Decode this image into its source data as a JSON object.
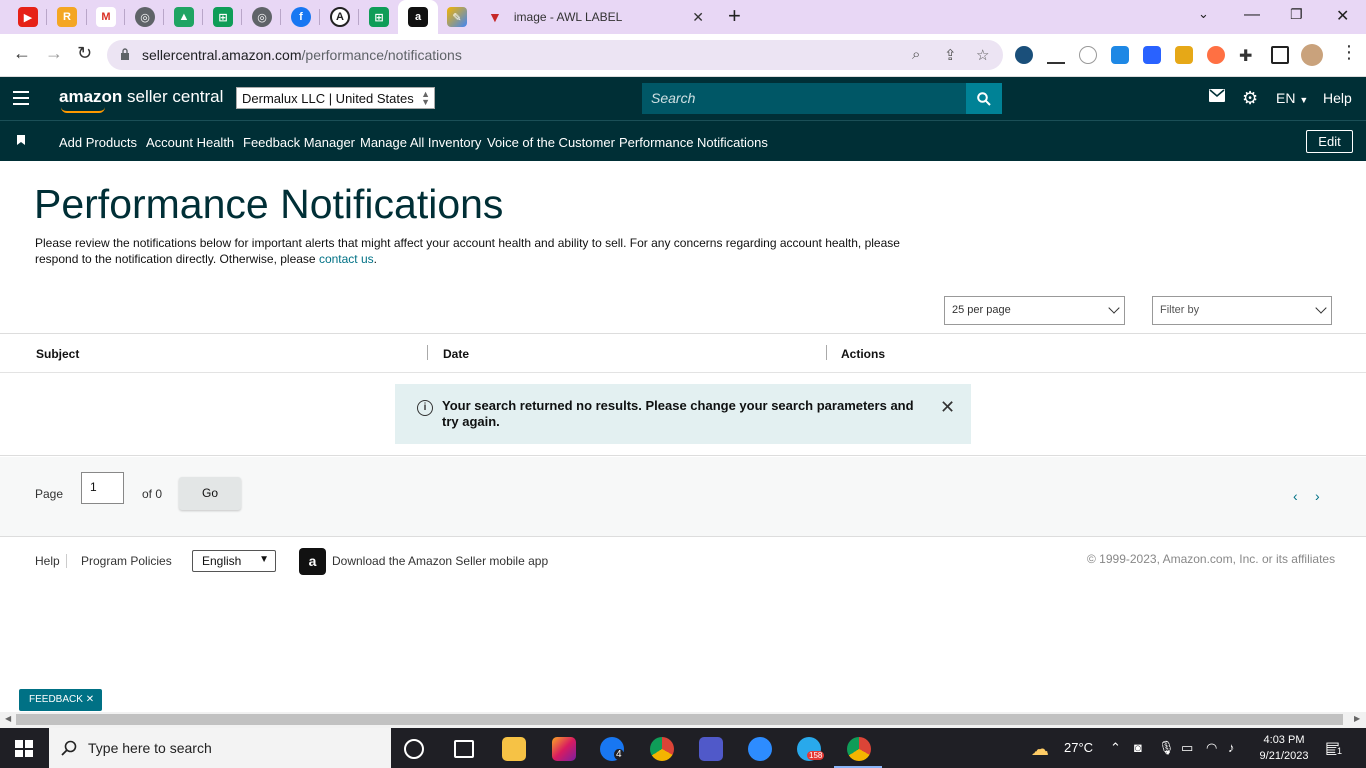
{
  "browser": {
    "tab_title": "image - AWL LABEL",
    "url_host": "sellercentral.amazon.com",
    "url_path": "/performance/notifications"
  },
  "header": {
    "brand_main": "amazon",
    "brand_sub": " seller central",
    "account_selector": "Dermalux LLC | United States",
    "search_placeholder": "Search",
    "language": "EN",
    "help": "Help"
  },
  "nav": {
    "items": [
      {
        "label": "Add Products"
      },
      {
        "label": "Account Health"
      },
      {
        "label": "Feedback Manager"
      },
      {
        "label": "Manage All Inventory"
      },
      {
        "label": "Voice of the Customer"
      },
      {
        "label": "Performance Notifications"
      }
    ],
    "edit_label": "Edit"
  },
  "page": {
    "title": "Performance Notifications",
    "description": "Please review the notifications below for important alerts that might affect your account health and ability to sell. For any concerns regarding account health, please respond to the notification directly. Otherwise, please ",
    "contact_link": "contact us",
    "description_end": "."
  },
  "filters": {
    "per_page": "25 per page",
    "filter_by": "Filter by"
  },
  "table": {
    "columns": [
      "Subject",
      "Date",
      "Actions"
    ],
    "empty_message": "Your search returned no results. Please change your search parameters and try again."
  },
  "pager": {
    "page_label": "Page",
    "page_value": "1",
    "of_label": "of 0",
    "go_label": "Go"
  },
  "footer": {
    "help": "Help",
    "program_policies": "Program Policies",
    "language": "English",
    "download_app": "Download the Amazon Seller mobile app",
    "copyright": "© 1999-2023, Amazon.com, Inc. or its affiliates"
  },
  "feedback": {
    "label": "FEEDBACK"
  },
  "taskbar": {
    "search_placeholder": "Type here to search",
    "weather": "27°C",
    "time": "4:03 PM",
    "date": "9/21/2023",
    "badges": {
      "edge": "4",
      "telegram": "158",
      "notifications": "1"
    }
  },
  "colors": {
    "header_bg": "#002f36",
    "search_bg": "#005766",
    "search_button": "#008296",
    "link": "#007185",
    "alert_bg": "#e3f0f1",
    "tabbar_bg": "#e8d7f5"
  }
}
